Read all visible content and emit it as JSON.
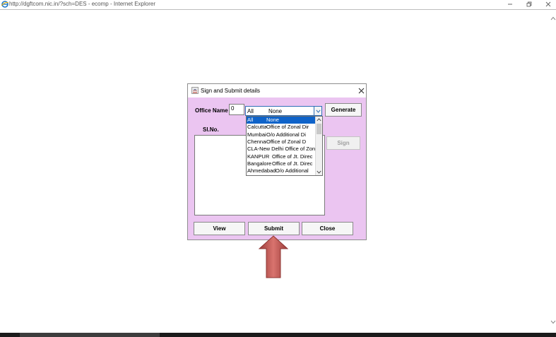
{
  "browser": {
    "title": "http://dgftcom.nic.in/?sch=DES - ecomp - Internet Explorer",
    "icons": {
      "app": "ie-icon",
      "minimize": "minimize-icon",
      "maximize": "restore-icon",
      "close": "close-icon"
    }
  },
  "dialog": {
    "title": "Sign and Submit details",
    "office_label": "Office Name",
    "office_input_value": "0",
    "combo_selected_code": "All",
    "combo_selected_name": "None",
    "dropdown_options": [
      {
        "code": "All",
        "name": "None",
        "selected": true
      },
      {
        "code": "Calcutta",
        "name": "Office of Zonal Dir"
      },
      {
        "code": "Mumbai",
        "name": "O/o Additional Di"
      },
      {
        "code": "Chennai",
        "name": "Office of Zonal D"
      },
      {
        "code": "CLA-New Delhi",
        "name": "Office of Zona"
      },
      {
        "code": "KANPUR",
        "name": "Office of Jt. Direc"
      },
      {
        "code": "Bangalore",
        "name": "Office of Jt. Direc"
      },
      {
        "code": "Ahmedabad",
        "name": "O/o Additional"
      }
    ],
    "generate_label": "Generate",
    "slno_label": "Sl.No.",
    "sign_label": "Sign",
    "view_label": "View",
    "submit_label": "Submit",
    "close_label": "Close"
  },
  "colors": {
    "dialog_body": "#ebc5f1",
    "selection": "#0f63c9",
    "arrow": "#b85450"
  }
}
